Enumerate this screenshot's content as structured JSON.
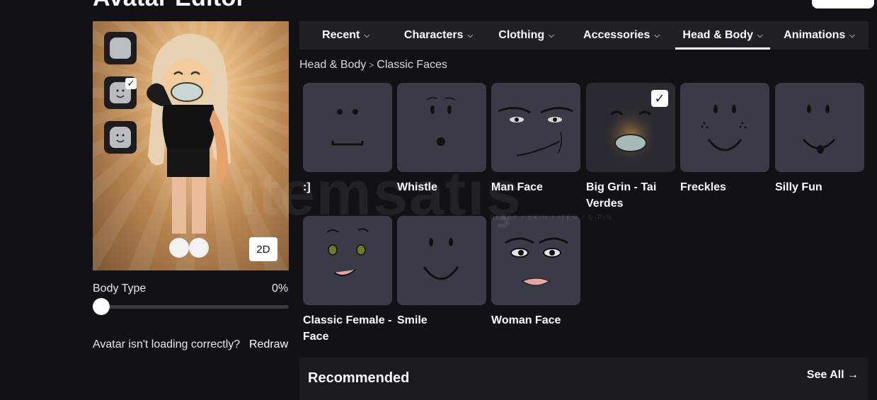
{
  "page": {
    "title": "Avatar Editor"
  },
  "preview": {
    "thumbnails": [
      {
        "icon": "plain-head-icon",
        "checked": false
      },
      {
        "icon": "smile-head-icon",
        "checked": true
      },
      {
        "icon": "smile-head-icon",
        "checked": false
      }
    ],
    "toggle_2d_label": "2D"
  },
  "body_type": {
    "label": "Body Type",
    "value": "0%"
  },
  "loading": {
    "message": "Avatar isn't loading correctly?",
    "redraw_label": "Redraw"
  },
  "tabs": [
    {
      "label": "Recent",
      "active": false
    },
    {
      "label": "Characters",
      "active": false
    },
    {
      "label": "Clothing",
      "active": false
    },
    {
      "label": "Accessories",
      "active": false
    },
    {
      "label": "Head & Body",
      "active": true
    },
    {
      "label": "Animations",
      "active": false
    }
  ],
  "breadcrumb": {
    "parent": "Head & Body",
    "current": "Classic Faces"
  },
  "items": [
    {
      "name": ":]",
      "checked": false
    },
    {
      "name": "Whistle",
      "checked": false
    },
    {
      "name": "Man Face",
      "checked": false
    },
    {
      "name": "Big Grin - Tai Verdes",
      "checked": true
    },
    {
      "name": "Freckles",
      "checked": false
    },
    {
      "name": "Silly Fun",
      "checked": false
    },
    {
      "name": "Classic Female - Face",
      "checked": false
    },
    {
      "name": "Smile",
      "checked": false
    },
    {
      "name": "Woman Face",
      "checked": false
    }
  ],
  "recommended": {
    "title": "Recommended",
    "see_all_label": "See All"
  },
  "watermark": {
    "text": "itemsatış",
    "subtext": "HESAP / SKIN / ITEM / E-PIN"
  },
  "colors": {
    "background": "#111216",
    "tile": "#393b47",
    "tabbar": "#1f2126"
  }
}
